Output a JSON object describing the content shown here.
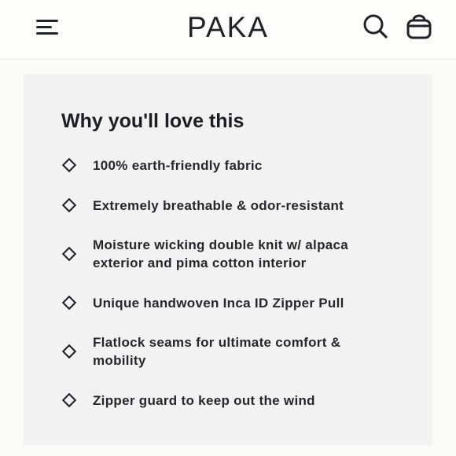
{
  "header": {
    "logo": "PAKA",
    "icons": {
      "menu": "hamburger-menu-icon",
      "search": "search-icon",
      "cart": "shopping-bag-icon"
    }
  },
  "features": {
    "title": "Why you'll love this",
    "bullet_icon": "diamond-outline-icon",
    "items": [
      "100% earth-friendly fabric",
      "Extremely breathable & odor-resistant",
      "Moisture wicking double knit w/ alpaca exterior and pima cotton interior",
      "Unique handwoven Inca ID Zipper Pull",
      "Flatlock seams for ultimate comfort & mobility",
      "Zipper guard to keep out the wind"
    ]
  },
  "colors": {
    "text": "#1d1d24",
    "panel_background": "#f2f2f3",
    "page_background": "#fbfbfa"
  }
}
